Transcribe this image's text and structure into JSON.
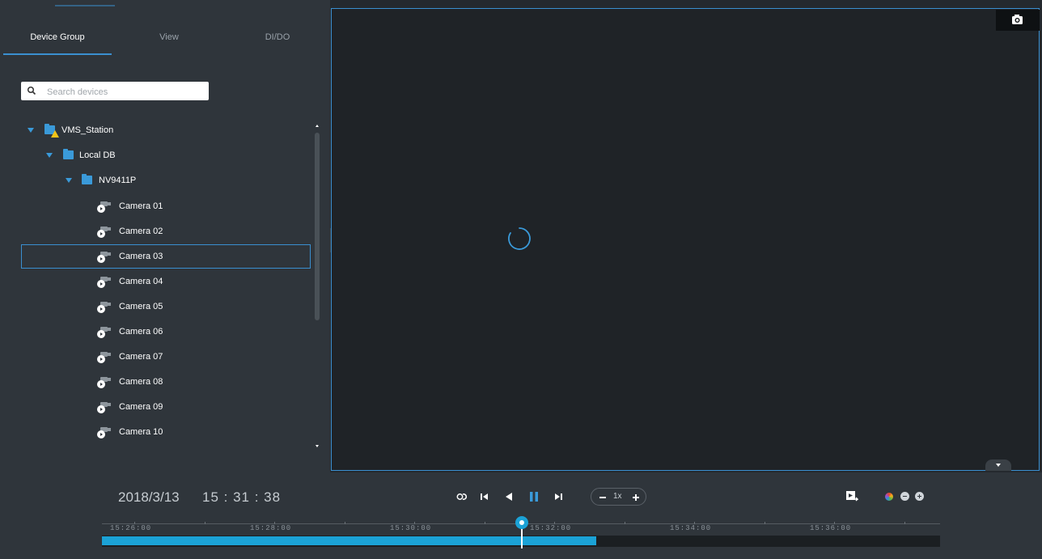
{
  "tabs": [
    {
      "label": "Device Group",
      "active": true
    },
    {
      "label": "View",
      "active": false
    },
    {
      "label": "DI/DO",
      "active": false
    }
  ],
  "search": {
    "placeholder": "Search devices",
    "value": ""
  },
  "tree": {
    "station": "VMS_Station",
    "db": "Local DB",
    "nvr": "NV9411P",
    "cameras": [
      "Camera 01",
      "Camera 02",
      "Camera 03",
      "Camera 04",
      "Camera 05",
      "Camera 06",
      "Camera 07",
      "Camera 08",
      "Camera 09",
      "Camera 10"
    ],
    "selected_camera": "Camera 03"
  },
  "playback": {
    "date": "2018/3/13",
    "time": "15 : 31 : 38",
    "speed": "1x"
  },
  "timeline": {
    "labels": [
      "15:26:00",
      "15:28:00",
      "15:30:00",
      "15:32:00",
      "15:34:00",
      "15:36:00"
    ],
    "recorded_fill_fraction": 0.59,
    "playhead_fraction": 0.501
  },
  "colors": {
    "accent": "#3a8fd0",
    "timeline_fill": "#1ba2d6",
    "warning": "#f2c318"
  },
  "icons": {
    "snapshot": "camera-snapshot-icon",
    "sync": "sync-link-icon",
    "prev": "skip-previous-icon",
    "reverse": "play-reverse-icon",
    "pause": "pause-icon",
    "next": "skip-next-icon",
    "export": "export-video-icon",
    "color": "color-adjust-icon",
    "zoom_out": "zoom-out-icon",
    "zoom_in": "zoom-in-icon"
  }
}
